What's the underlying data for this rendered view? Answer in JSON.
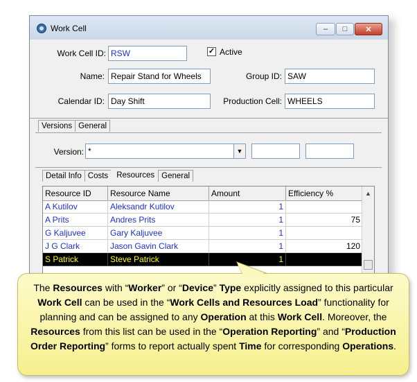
{
  "window": {
    "title": "Work Cell",
    "min_glyph": "–",
    "max_glyph": "□",
    "close_glyph": "✕",
    "icon": "gear-icon"
  },
  "header": {
    "work_cell_id_label": "Work Cell ID:",
    "work_cell_id_value": "RSW",
    "active_label": "Active",
    "active_checked": true,
    "active_mark": "✓",
    "name_label": "Name:",
    "name_value": "Repair Stand for Wheels",
    "group_id_label": "Group ID:",
    "group_id_value": "SAW",
    "calendar_id_label": "Calendar ID:",
    "calendar_id_value": "Day Shift",
    "production_cell_label": "Production Cell:",
    "production_cell_value": "WHEELS"
  },
  "outer_tabs": [
    "Versions",
    "General"
  ],
  "version": {
    "label": "Version:",
    "value": "*",
    "dropdown_glyph": "▼",
    "extra1": "",
    "extra2": ""
  },
  "inner_tabs": [
    "Detail Info",
    "Costs",
    "Resources",
    "General"
  ],
  "grid": {
    "columns": [
      "Resource ID",
      "Resource Name",
      "Amount",
      "Efficiency %"
    ],
    "rows": [
      {
        "id": "A Kutilov",
        "name": "Aleksandr Kutilov",
        "amount": "1",
        "efficiency": ""
      },
      {
        "id": "A Prits",
        "name": "Andres Prits",
        "amount": "1",
        "efficiency": "75"
      },
      {
        "id": "G Kaljuvee",
        "name": "Gary Kaljuvee",
        "amount": "1",
        "efficiency": ""
      },
      {
        "id": "J G Clark",
        "name": "Jason Gavin Clark",
        "amount": "1",
        "efficiency": "120"
      },
      {
        "id": "S Patrick",
        "name": "Steve Patrick",
        "amount": "1",
        "efficiency": ""
      }
    ],
    "selected_index": 4,
    "scroll_up_glyph": "▲"
  },
  "callout": {
    "segments": [
      {
        "t": "The ",
        "b": false
      },
      {
        "t": "Resources",
        "b": true
      },
      {
        "t": " with “",
        "b": false
      },
      {
        "t": "Worker",
        "b": true
      },
      {
        "t": "” or “",
        "b": false
      },
      {
        "t": "Device",
        "b": true
      },
      {
        "t": "” ",
        "b": false
      },
      {
        "t": "Type",
        "b": true
      },
      {
        "t": " explicitly assigned to this particular ",
        "b": false
      },
      {
        "t": "Work Cell",
        "b": true
      },
      {
        "t": " can be used in the “",
        "b": false
      },
      {
        "t": "Work Cells and Resources Load",
        "b": true
      },
      {
        "t": "” functionality for planning and can be assigned to any ",
        "b": false
      },
      {
        "t": "Operation",
        "b": true
      },
      {
        "t": " at this ",
        "b": false
      },
      {
        "t": "Work Cell",
        "b": true
      },
      {
        "t": ".  Moreover, the ",
        "b": false
      },
      {
        "t": "Resources",
        "b": true
      },
      {
        "t": " from this list can be used in the “",
        "b": false
      },
      {
        "t": "Operation Reporting",
        "b": true
      },
      {
        "t": "” and “",
        "b": false
      },
      {
        "t": "Production Order Reporting",
        "b": true
      },
      {
        "t": "” forms to report actually spent ",
        "b": false
      },
      {
        "t": "Time",
        "b": true
      },
      {
        "t": " for corresponding ",
        "b": false
      },
      {
        "t": "Operations",
        "b": true
      },
      {
        "t": ".",
        "b": false
      }
    ]
  },
  "colors": {
    "link_blue": "#1f2fd0",
    "selected_bg": "#000000",
    "selected_fg": "#ffff00",
    "callout_bg": "#f9f4ad"
  }
}
